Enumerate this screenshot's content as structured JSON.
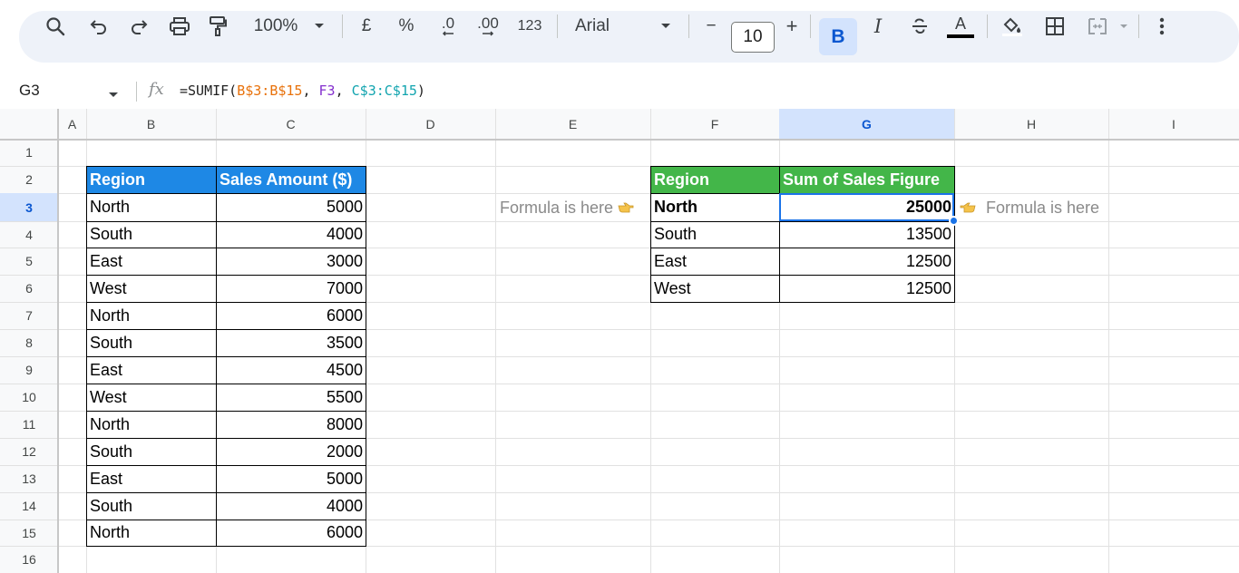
{
  "toolbar": {
    "zoom": "100%",
    "currency": "£",
    "percent": "%",
    "decrease_decimal": ".0",
    "increase_decimal": ".00",
    "number_format": "123",
    "font": "Arial",
    "font_size": "10",
    "minus": "−",
    "plus": "+",
    "bold": "B",
    "italic": "I",
    "text_color_letter": "A"
  },
  "formula_bar": {
    "name_box": "G3",
    "fx": "fx",
    "formula_parts": [
      "=SUMIF(",
      "B$3:B$15",
      ", ",
      "F3",
      ", ",
      "C$3:C$15",
      ")"
    ]
  },
  "columns": [
    "A",
    "B",
    "C",
    "D",
    "E",
    "F",
    "G",
    "H",
    "I"
  ],
  "active_column": "G",
  "rows": [
    "1",
    "2",
    "3",
    "4",
    "5",
    "6",
    "7",
    "8",
    "9",
    "10",
    "11",
    "12",
    "13",
    "14",
    "15",
    "16"
  ],
  "active_row": "3",
  "sales_table": {
    "header": [
      "Region",
      "Sales Amount ($)"
    ],
    "rows": [
      [
        "North",
        "5000"
      ],
      [
        "South",
        "4000"
      ],
      [
        "East",
        "3000"
      ],
      [
        "West",
        "7000"
      ],
      [
        "North",
        "6000"
      ],
      [
        "South",
        "3500"
      ],
      [
        "East",
        "4500"
      ],
      [
        "West",
        "5500"
      ],
      [
        "North",
        "8000"
      ],
      [
        "South",
        "2000"
      ],
      [
        "East",
        "5000"
      ],
      [
        "South",
        "4000"
      ],
      [
        "North",
        "6000"
      ]
    ],
    "header_color": "#1e88e5"
  },
  "summary_table": {
    "header": [
      "Region",
      "Sum of Sales Figure"
    ],
    "rows": [
      [
        "North",
        "25000"
      ],
      [
        "South",
        "13500"
      ],
      [
        "East",
        "12500"
      ],
      [
        "West",
        "12500"
      ]
    ],
    "header_color": "#43b649"
  },
  "notes": {
    "left": "Formula is here",
    "right": "Formula is here",
    "left_icon": "pointing-right-hand-icon",
    "right_icon": "pointing-left-hand-icon"
  },
  "colors": {
    "selection": "#1a73e8",
    "toolbar_bg": "#eef2f9"
  }
}
